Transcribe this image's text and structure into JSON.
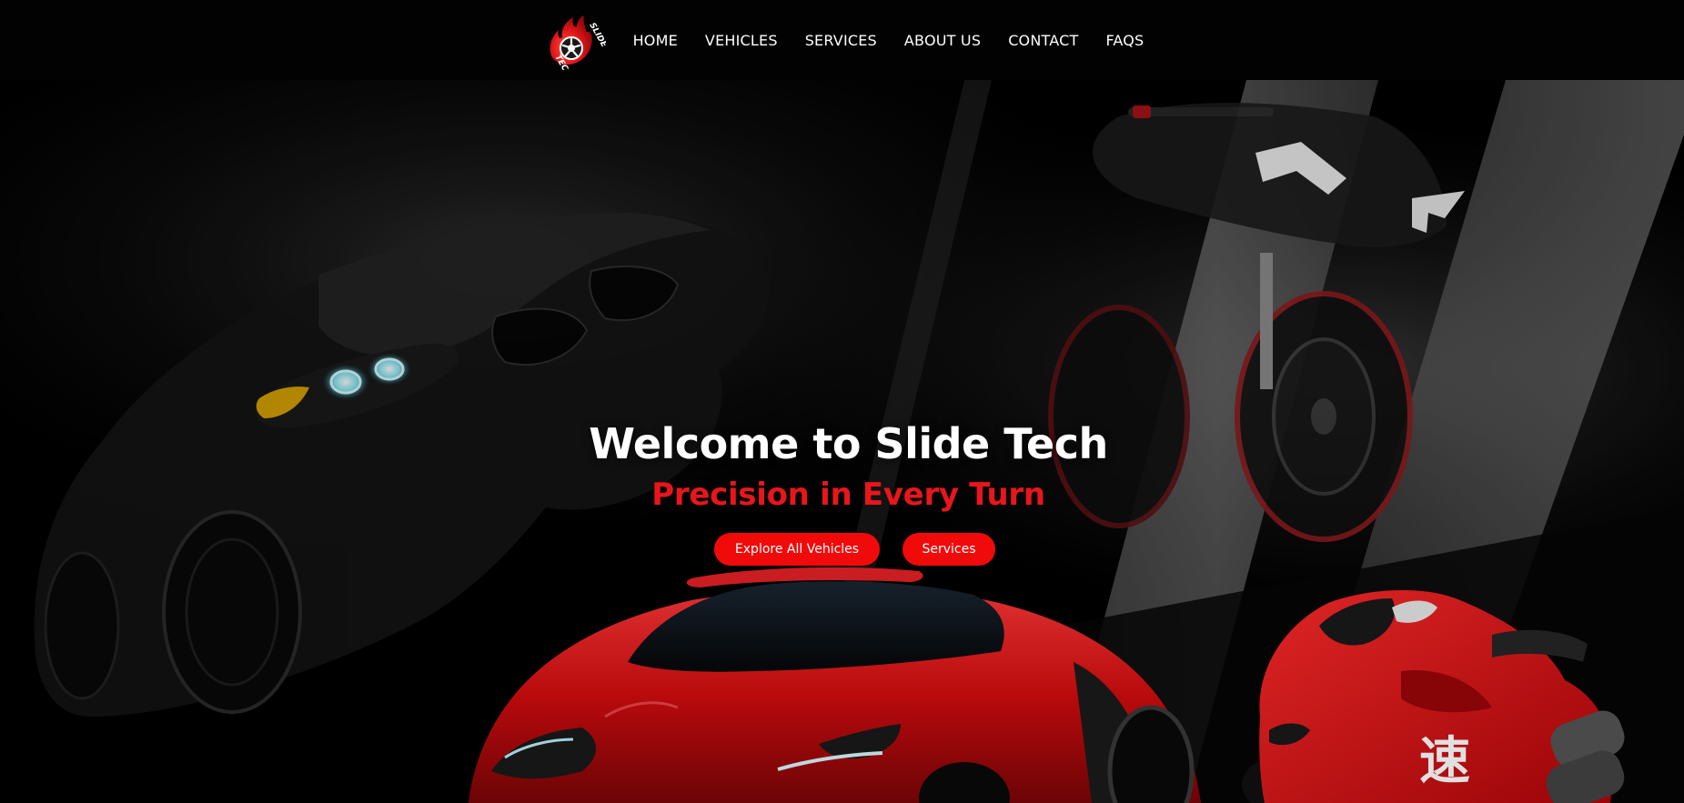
{
  "brand": {
    "logo_text_top": "SLIDE",
    "logo_text_bottom": "TECH",
    "accent_color": "#f10a0a"
  },
  "nav": {
    "items": [
      {
        "label": "HOME"
      },
      {
        "label": "VEHICLES"
      },
      {
        "label": "SERVICES"
      },
      {
        "label": "ABOUT US"
      },
      {
        "label": "CONTACT"
      },
      {
        "label": "FAQS"
      }
    ]
  },
  "hero": {
    "title": "Welcome to Slide Tech",
    "subtitle": "Precision in Every Turn",
    "primary_button": "Explore All Vehicles",
    "secondary_button": "Services",
    "bike_glyph": "速"
  }
}
